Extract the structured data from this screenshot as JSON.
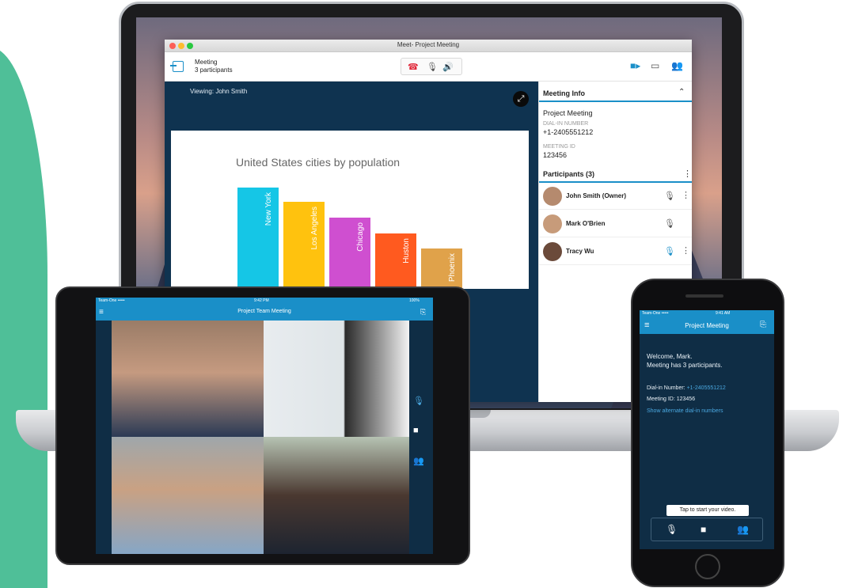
{
  "laptop_app": {
    "window_title": "Meet- Project Meeting",
    "toolbar": {
      "meeting_label": "Meeting",
      "participants_count": "3 participants"
    },
    "stage": {
      "viewing_label": "Viewing: John Smith"
    },
    "meeting_info": {
      "header": "Meeting Info",
      "name": "Project Meeting",
      "dial_in_label": "DIAL-IN NUMBER",
      "dial_in_number": "+1-2405551212",
      "meeting_id_label": "MEETING ID",
      "meeting_id": "123456"
    },
    "participants": {
      "header": "Participants (3)",
      "list": [
        {
          "name": "John Smith (Owner)",
          "avatar_color": "#b58a6e"
        },
        {
          "name": "Mark O'Brien",
          "avatar_color": "#c79b7a"
        },
        {
          "name": "Tracy Wu",
          "avatar_color": "#6b4a3a"
        }
      ]
    }
  },
  "chart_data": {
    "type": "bar",
    "title": "United States cities by population",
    "categories": [
      "New York",
      "Los Angeles",
      "Chicago",
      "Huston",
      "Phoenix"
    ],
    "values": [
      100,
      86,
      70,
      55,
      40
    ],
    "colors": [
      "#15c6e6",
      "#ffc20e",
      "#cf4fd0",
      "#ff5a1f",
      "#e0a24a"
    ]
  },
  "tablet_app": {
    "status": "Team-One ••••• ",
    "time": "9:42 PM",
    "battery": "100%",
    "title": "Project Team Meeting"
  },
  "phone_app": {
    "status": "Team-One ••••• ",
    "time": "9:41 AM",
    "title": "Project Meeting",
    "welcome": "Welcome, Mark.",
    "participants_text": "Meeting has 3 participants.",
    "dial_in_label": "Dial-in Number: ",
    "dial_in_number": "+1-2405551212",
    "meeting_id_text": "Meeting ID: 123456",
    "alt_numbers_link": "Show alternate dial-in numbers",
    "tooltip": "Tap to start your video."
  },
  "colors": {
    "accent": "#1a8fc8",
    "dark_bg": "#0f2d45",
    "green": "#4fbf98"
  }
}
